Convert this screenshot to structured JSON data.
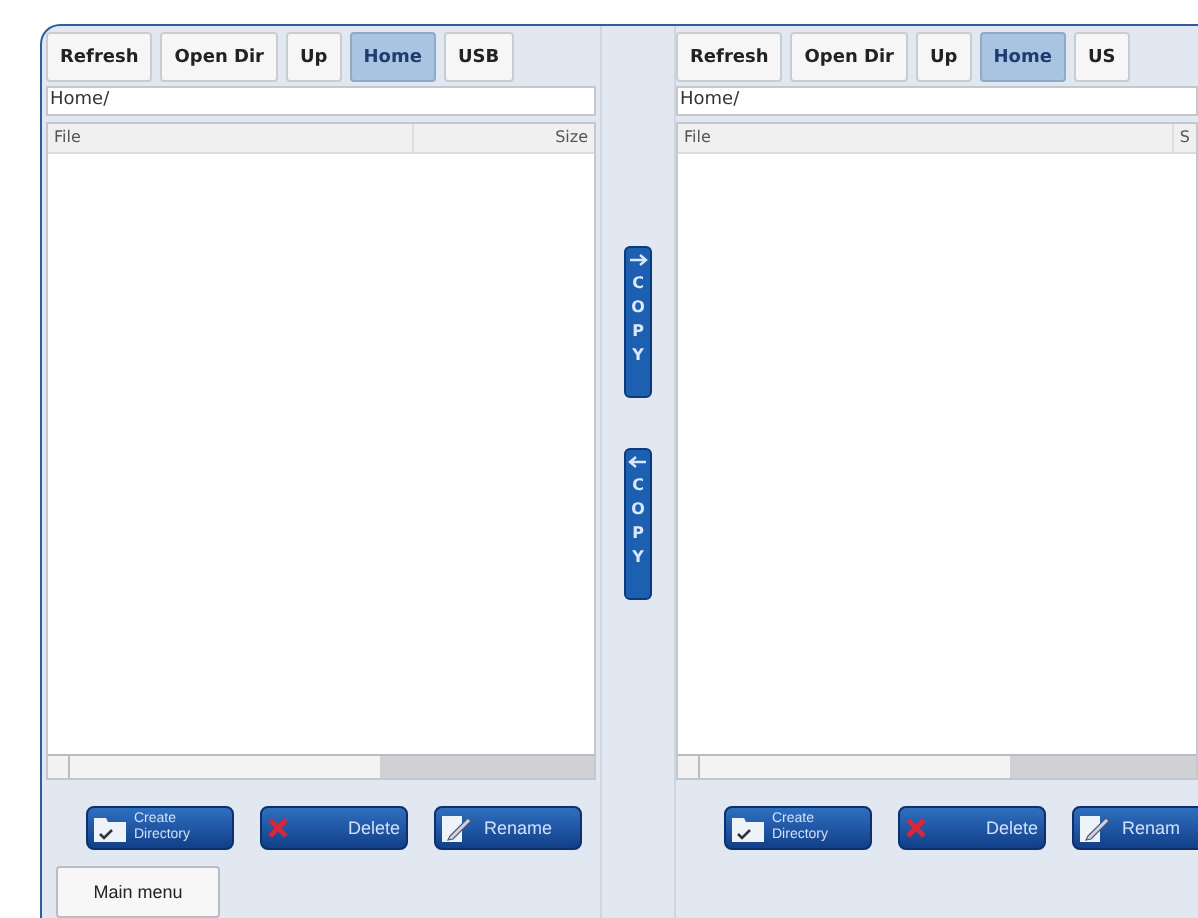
{
  "panes": [
    {
      "toolbar": [
        {
          "label": "Refresh",
          "selected": false
        },
        {
          "label": "Open Dir",
          "selected": false
        },
        {
          "label": "Up",
          "selected": false
        },
        {
          "label": "Home",
          "selected": true
        },
        {
          "label": "USB",
          "selected": false
        }
      ],
      "path": "Home/",
      "columns": [
        "File",
        "Size"
      ],
      "actions": [
        {
          "kind": "create",
          "label": "Create Directory"
        },
        {
          "kind": "delete",
          "label": "Delete"
        },
        {
          "kind": "rename",
          "label": "Rename"
        }
      ]
    },
    {
      "toolbar": [
        {
          "label": "Refresh",
          "selected": false
        },
        {
          "label": "Open Dir",
          "selected": false
        },
        {
          "label": "Up",
          "selected": false
        },
        {
          "label": "Home",
          "selected": true
        },
        {
          "label": "US",
          "selected": false
        }
      ],
      "path": "Home/",
      "columns": [
        "File",
        "S"
      ],
      "actions": [
        {
          "kind": "create",
          "label": "Create Directory"
        },
        {
          "kind": "delete",
          "label": "Delete"
        },
        {
          "kind": "rename",
          "label": "Renam"
        }
      ]
    }
  ],
  "copy_buttons": [
    {
      "kind": "to-right",
      "label": "COPY"
    },
    {
      "kind": "to-left",
      "label": "COPY"
    }
  ],
  "main_menu": "Main menu"
}
